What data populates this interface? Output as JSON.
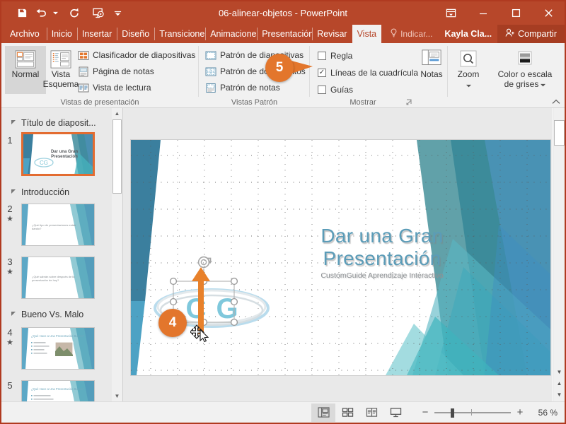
{
  "window": {
    "title": "06-alinear-objetos  -  PowerPoint",
    "quick_access": [
      {
        "name": "save-icon",
        "label": "Guardar"
      },
      {
        "name": "undo-icon",
        "label": "Deshacer"
      },
      {
        "name": "redo-icon",
        "label": "Rehacer"
      },
      {
        "name": "start-presentation-icon",
        "label": "Comenzar presentación"
      },
      {
        "name": "customize-qat-icon",
        "label": "Personalizar barra de herramientas"
      }
    ],
    "controls": [
      {
        "name": "ribbon-display-options-icon",
        "glyph": "⬒"
      },
      {
        "name": "minimize-icon",
        "glyph": "—"
      },
      {
        "name": "maximize-icon",
        "glyph": "☐"
      },
      {
        "name": "close-icon",
        "glyph": "✕"
      }
    ],
    "accent": "#b7472a"
  },
  "tabs": [
    {
      "label": "Archivo",
      "active": false
    },
    {
      "label": "Inicio",
      "active": false
    },
    {
      "label": "Insertar",
      "active": false
    },
    {
      "label": "Diseño",
      "active": false
    },
    {
      "label": "Transiciones",
      "active": false
    },
    {
      "label": "Animaciones",
      "active": false
    },
    {
      "label": "Presentación",
      "active": false
    },
    {
      "label": "Revisar",
      "active": false
    },
    {
      "label": "Vista",
      "active": true
    }
  ],
  "tab_right": {
    "tell_me": "Indicar...",
    "account": "Kayla Cla...",
    "share": "Compartir"
  },
  "ribbon": {
    "groups": [
      {
        "name": "vistas-presentacion",
        "label": "Vistas de presentación",
        "big_buttons": [
          {
            "label1": "Normal",
            "label2": "",
            "selected": true,
            "icon": "normal-view-icon"
          },
          {
            "label1": "Vista",
            "label2": "Esquema",
            "selected": false,
            "icon": "outline-view-icon"
          }
        ],
        "small_items": [
          {
            "label": "Clasificador de diapositivas",
            "icon": "slide-sorter-icon"
          },
          {
            "label": "Página de notas",
            "icon": "notes-page-icon"
          },
          {
            "label": "Vista de lectura",
            "icon": "reading-view-icon"
          }
        ]
      },
      {
        "name": "vistas-patron",
        "label": "Vistas Patrón",
        "small_items": [
          {
            "label": "Patrón de diapositivas",
            "icon": "slide-master-icon"
          },
          {
            "label": "Patrón de documentos",
            "icon": "handout-master-icon"
          },
          {
            "label": "Patrón de notas",
            "icon": "notes-master-icon"
          }
        ]
      },
      {
        "name": "mostrar",
        "label": "Mostrar",
        "checkboxes": [
          {
            "label": "Regla",
            "checked": false
          },
          {
            "label": "Líneas de la cuadrícula",
            "checked": true
          },
          {
            "label": "Guías",
            "checked": false
          }
        ]
      },
      {
        "name": "notas-zoom-color",
        "buttons": [
          {
            "label1": "Notas",
            "label2": "",
            "icon": "notes-icon",
            "dropdown": false
          },
          {
            "label1": "Zoom",
            "label2": "",
            "icon": "zoom-magnifier-icon",
            "dropdown": true
          },
          {
            "label1": "Color o escala",
            "label2": "de grises",
            "icon": "color-grayscale-icon",
            "dropdown": true
          }
        ]
      }
    ],
    "collapse_icon": "collapse-ribbon-icon"
  },
  "thumbnails": {
    "sections": [
      {
        "title": "Título de diaposit...",
        "slides": [
          {
            "number": "1",
            "star": false,
            "selected": true,
            "kind": "title",
            "title": "Dar una Gran Presentación"
          }
        ]
      },
      {
        "title": "Introducción",
        "slides": [
          {
            "number": "2",
            "star": true,
            "selected": false,
            "kind": "text",
            "title": "¿Qué tipo de presentaciones están dando?"
          },
          {
            "number": "3",
            "star": true,
            "selected": false,
            "kind": "text",
            "title": "¿Qué sabrán sobre después de la presentación de hoy?"
          }
        ]
      },
      {
        "title": "Bueno Vs. Malo",
        "slides": [
          {
            "number": "4",
            "star": true,
            "selected": false,
            "kind": "bullets-image",
            "title": "¿Qué Hace a Una Presentación Bueno?"
          },
          {
            "number": "5",
            "star": false,
            "selected": false,
            "kind": "bullets",
            "title": "¿Qué Hace a Una Presentación Bueno?"
          }
        ]
      }
    ]
  },
  "slide": {
    "title_line1": "Dar una Gran",
    "title_line2": "Presentación",
    "subtitle": "CustomGuide Aprendizaje Interactivo",
    "logo_text_1": "C",
    "logo_text_2": "G",
    "title_color": "#5b9cb8",
    "gridlines_visible": true
  },
  "callouts": [
    {
      "number": "4",
      "target": "selected-logo-object",
      "kind": "drag-up-arrow"
    },
    {
      "number": "5",
      "target": "gridlines-checkbox",
      "kind": "pointer-right"
    }
  ],
  "statusbar": {
    "view_buttons": [
      {
        "name": "normal-view-button",
        "active": true
      },
      {
        "name": "slide-sorter-button",
        "active": false
      },
      {
        "name": "reading-view-button",
        "active": false
      },
      {
        "name": "slideshow-button",
        "active": false
      }
    ],
    "zoom_out": "−",
    "zoom_in": "+",
    "zoom_percent": "56 %",
    "fit_slide": "fit-slide-icon"
  }
}
